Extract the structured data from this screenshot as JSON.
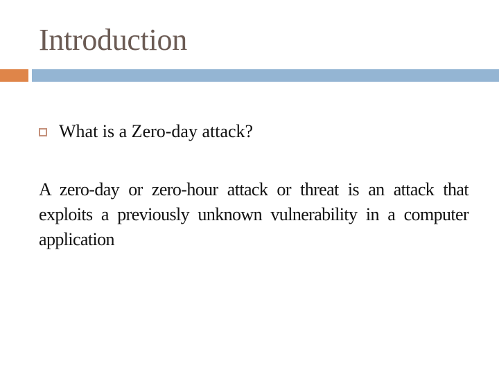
{
  "slide": {
    "title": "Introduction",
    "accent_colors": {
      "title_text": "#6b5b54",
      "accent_bar": "#df8549",
      "main_bar": "#94b5d3",
      "bullet": "#c4907a"
    },
    "bullets": [
      {
        "icon": "hollow-square-bullet",
        "text": "What is a Zero-day attack?"
      }
    ],
    "paragraph": "A zero-day or zero-hour attack or threat is an attack that exploits a previously unknown vulnerability in a computer application"
  }
}
